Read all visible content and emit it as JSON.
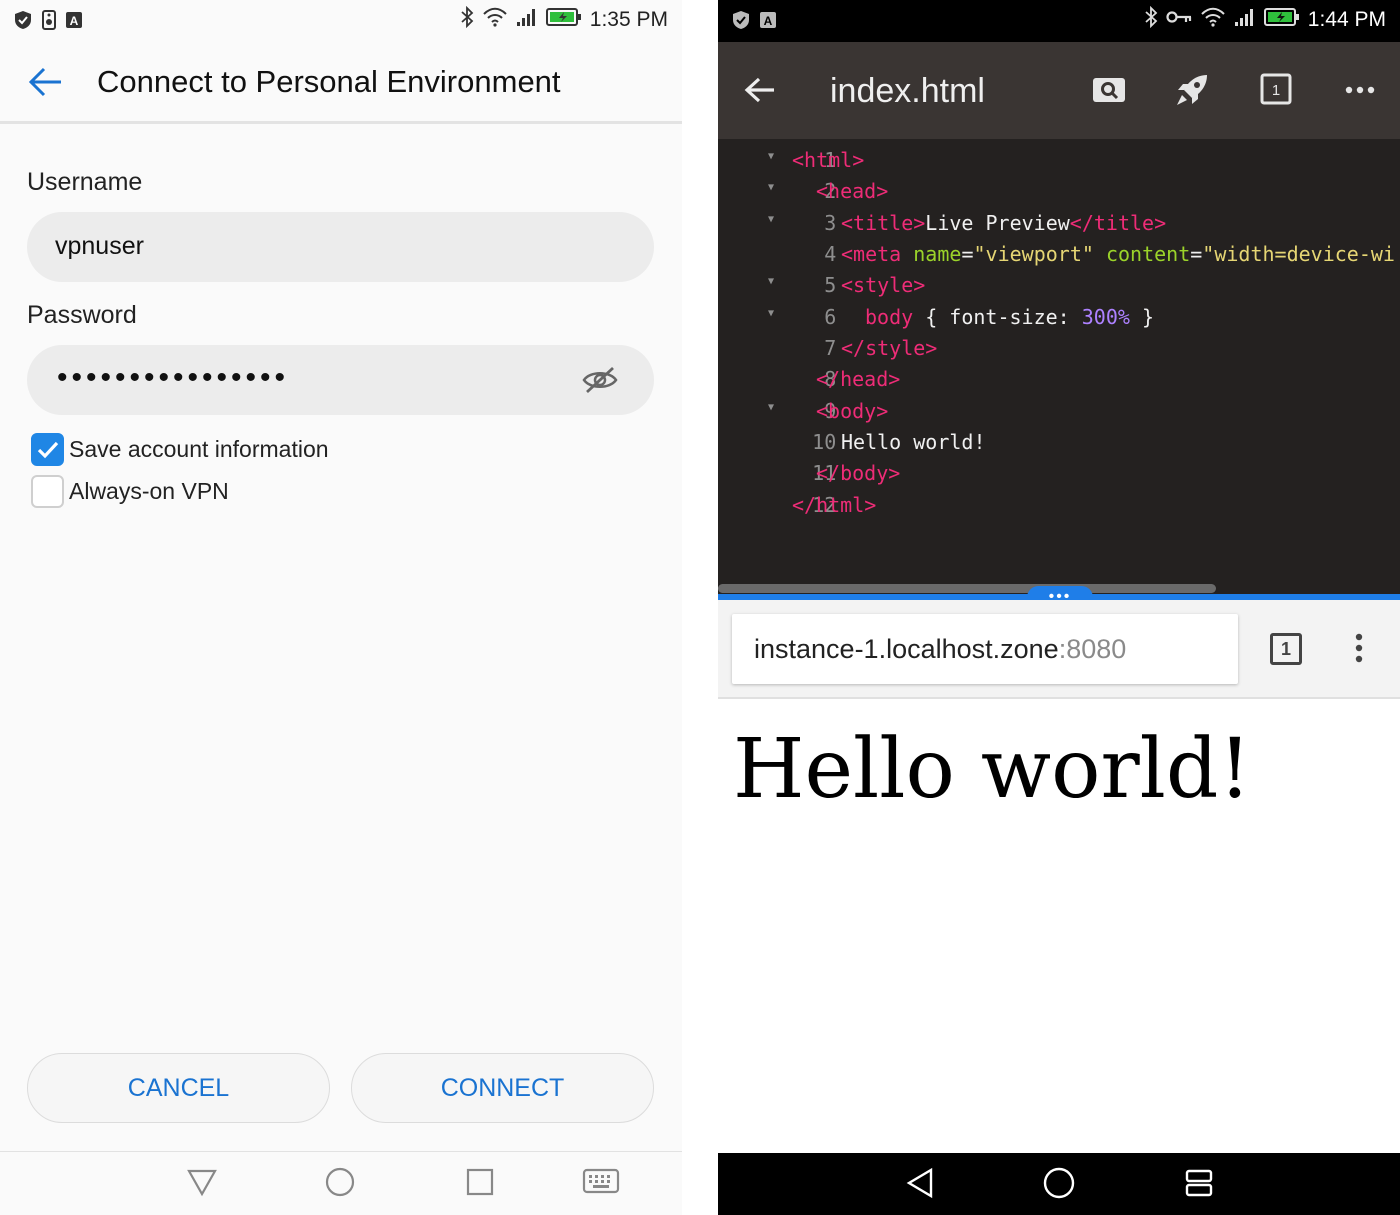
{
  "left_screen": {
    "status_bar": {
      "time": "1:35 PM"
    },
    "app_bar": {
      "title": "Connect to Personal Environment"
    },
    "username": {
      "label": "Username",
      "value": "vpnuser"
    },
    "password": {
      "label": "Password",
      "masked_value": "••••••••••••••••"
    },
    "options": [
      {
        "label": "Save account information",
        "checked": true
      },
      {
        "label": "Always-on VPN",
        "checked": false
      }
    ],
    "buttons": {
      "cancel": "CANCEL",
      "connect": "CONNECT"
    },
    "nav_bar": [
      "back-triangle-icon",
      "home-circle-icon",
      "recents-square-icon",
      "keyboard-icon"
    ]
  },
  "right_screen": {
    "status_bar": {
      "time": "1:44 PM"
    },
    "app_bar": {
      "title": "index.html",
      "actions": [
        "search-icon",
        "rocket-icon",
        "tabs-icon",
        "more-icon"
      ],
      "tab_count": "1"
    },
    "editor": {
      "lines": [
        {
          "n": "1",
          "fold": true
        },
        {
          "n": "2",
          "fold": true
        },
        {
          "n": "3",
          "fold": true
        },
        {
          "n": "4",
          "fold": false
        },
        {
          "n": "5",
          "fold": true
        },
        {
          "n": "6",
          "fold": true
        },
        {
          "n": "7",
          "fold": false
        },
        {
          "n": "8",
          "fold": false
        },
        {
          "n": "9",
          "fold": true
        },
        {
          "n": "10",
          "fold": false
        },
        {
          "n": "11",
          "fold": false
        },
        {
          "n": "12",
          "fold": false
        }
      ],
      "tokens": {
        "l1": [
          "<html>"
        ],
        "l2": [
          "<head>"
        ],
        "l3": [
          "<title>",
          "Live Preview",
          "</title>"
        ],
        "l4": [
          "<meta",
          " ",
          "name",
          "=",
          "\"viewport\"",
          " ",
          "content",
          "=",
          "\"width=device-wi"
        ],
        "l5": [
          "<style>"
        ],
        "l6": [
          "body",
          " { font-size: ",
          "300%",
          " }"
        ],
        "l7": [
          "</style>"
        ],
        "l8": [
          "</head>"
        ],
        "l9": [
          "<body>"
        ],
        "l10": [
          "Hello world!"
        ],
        "l11": [
          "</body>"
        ],
        "l12": [
          "</html>"
        ]
      }
    },
    "splitter_handle": "•••",
    "browser": {
      "url_host": "instance-1.localhost.zone",
      "url_port": ":8080",
      "tab_count": "1",
      "page_text": "Hello world!"
    },
    "nav_bar": [
      "back-triangle-icon",
      "home-circle-icon",
      "recents-stack-icon"
    ]
  },
  "colors": {
    "accent_blue": "#1f86e5",
    "code_tag": "#ee2c77",
    "code_attr": "#9bd32a",
    "code_string": "#e6d674",
    "code_number": "#ad81ff",
    "editor_bg": "#242120",
    "toolbar_bg": "#3a3533"
  }
}
